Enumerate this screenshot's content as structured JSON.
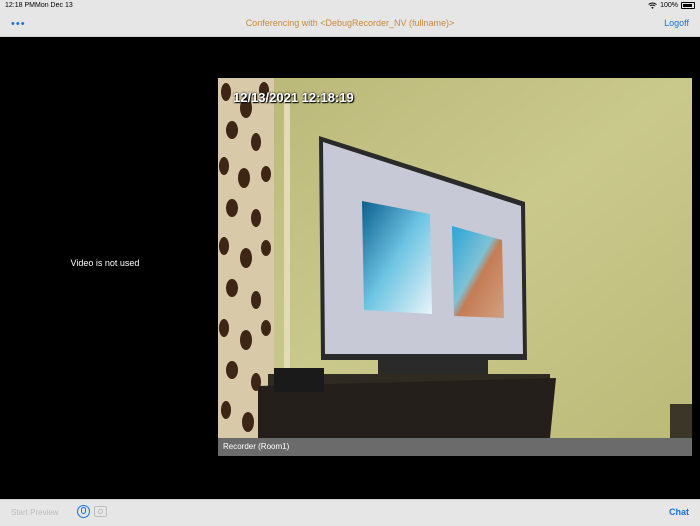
{
  "status_bar": {
    "time": "12:18 PM",
    "date": "Mon Dec 13",
    "battery_percent": "100%",
    "wifi_icon": "wifi-icon",
    "battery_icon": "battery-icon"
  },
  "header": {
    "title": "Conferencing with <DebugRecorder_NV (fullname)>",
    "logoff_label": "Logoff",
    "more_icon": "ellipsis-icon",
    "more_label": "•••"
  },
  "left_panel": {
    "message": "Video is not used"
  },
  "video": {
    "timestamp": "12/13/2021 12:18:19",
    "label": "Recorder (Room1)"
  },
  "footer": {
    "start_preview_label": "Start Preview",
    "chat_label": "Chat",
    "mic_icon": "microphone-icon",
    "camera_icon": "camera-icon"
  },
  "colors": {
    "accent": "#1a73d9",
    "title": "#c98a39",
    "bar_bg": "#e6e6e6"
  }
}
